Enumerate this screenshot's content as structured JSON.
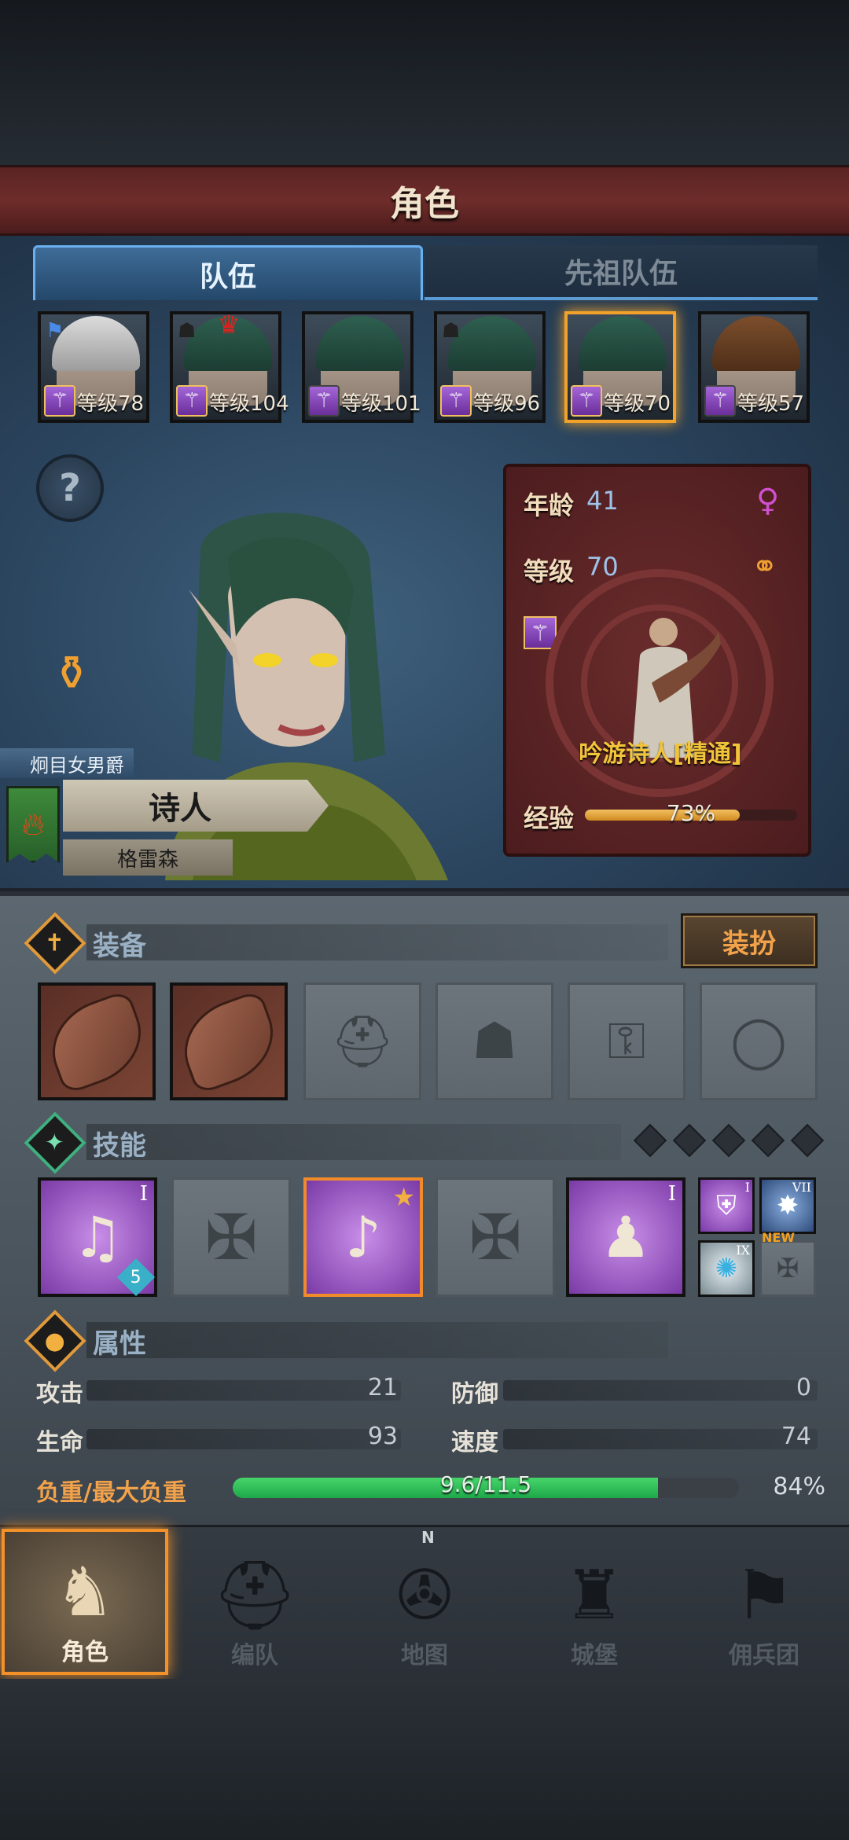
{
  "header": {
    "title": "角色"
  },
  "tabs": [
    {
      "label": "队伍",
      "active": true
    },
    {
      "label": "先祖队伍",
      "active": false
    }
  ],
  "roster": [
    {
      "level_label": "等级78",
      "hair": "white",
      "selected": false
    },
    {
      "level_label": "等级104",
      "hair": "green",
      "selected": false
    },
    {
      "level_label": "等级101",
      "hair": "green",
      "selected": false
    },
    {
      "level_label": "等级96",
      "hair": "green",
      "selected": false
    },
    {
      "level_label": "等级70",
      "hair": "green",
      "selected": true
    },
    {
      "level_label": "等级57",
      "hair": "brown",
      "selected": false
    }
  ],
  "help_icon": "?",
  "character": {
    "noble_title": "炯目女男爵",
    "class_name": "诗人",
    "origin": "格雷森",
    "banner_icon": "fire-icon"
  },
  "info": {
    "age_label": "年龄",
    "age_value": "41",
    "gender_icon": "female-icon",
    "level_label": "等级",
    "level_value": "70",
    "rings_icon": "wedding-rings-icon",
    "profession": "吟游诗人[精通]",
    "exp_label": "经验",
    "exp_text": "73%",
    "exp_percent": 73
  },
  "equipment": {
    "title": "装备",
    "dress_button": "装扮",
    "slots": [
      "shield",
      "shield",
      "helmet-empty",
      "armor-empty",
      "boots-empty",
      "ring-empty"
    ]
  },
  "skills": {
    "title": "技能",
    "slots": [
      {
        "state": "filled",
        "roman": "I",
        "badge": "5"
      },
      {
        "state": "empty"
      },
      {
        "state": "filled-selected",
        "roman": ""
      },
      {
        "state": "empty"
      },
      {
        "state": "filled",
        "roman": "I"
      }
    ],
    "minis": [
      {
        "roman": "I"
      },
      {
        "roman": "VII"
      },
      {
        "roman": "IX"
      },
      {
        "label": "NEW"
      }
    ]
  },
  "attributes": {
    "title": "属性",
    "attack_label": "攻击",
    "attack_value": "21",
    "defense_label": "防御",
    "defense_value": "0",
    "hp_label": "生命",
    "hp_value": "93",
    "speed_label": "速度",
    "speed_value": "74",
    "load_label": "负重/最大负重",
    "load_text": "9.6/11.5",
    "load_percent_text": "84%",
    "load_percent": 84
  },
  "nav": [
    {
      "label": "角色",
      "icon": "knight-icon",
      "active": true
    },
    {
      "label": "编队",
      "icon": "helmet-icon",
      "active": false
    },
    {
      "label": "地图",
      "icon": "compass-icon",
      "active": false
    },
    {
      "label": "城堡",
      "icon": "castle-icon",
      "active": false
    },
    {
      "label": "佣兵团",
      "icon": "banner-icon",
      "active": false
    }
  ],
  "compass_letter": "N",
  "colors": {
    "accent_orange": "#f2902a",
    "tab_blue": "#5a9ad4",
    "card_red": "#5e2626",
    "load_green": "#1ea84a"
  }
}
